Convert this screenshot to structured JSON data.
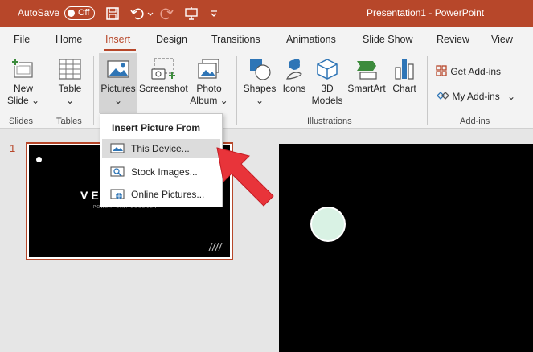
{
  "titlebar": {
    "autosave_label": "AutoSave",
    "autosave_state": "Off",
    "document_title": "Presentation1 - PowerPoint",
    "color": "#b7472a"
  },
  "tabs": [
    {
      "label": "File"
    },
    {
      "label": "Home"
    },
    {
      "label": "Insert",
      "active": true
    },
    {
      "label": "Design"
    },
    {
      "label": "Transitions"
    },
    {
      "label": "Animations"
    },
    {
      "label": "Slide Show"
    },
    {
      "label": "Review"
    },
    {
      "label": "View"
    }
  ],
  "ribbon": {
    "slides_group": {
      "new_slide_line1": "New",
      "new_slide_line2": "Slide",
      "label": "Slides"
    },
    "tables_group": {
      "table_label": "Table",
      "label": "Tables"
    },
    "images_group": {
      "pictures_label": "Pictures",
      "screenshot_label": "Screenshot",
      "photo_album_line1": "Photo",
      "photo_album_line2": "Album"
    },
    "illustrations_group": {
      "shapes_label": "Shapes",
      "icons_label": "Icons",
      "models_line1": "3D",
      "models_line2": "Models",
      "smartart_label": "SmartArt",
      "chart_label": "Chart",
      "label": "Illustrations"
    },
    "addins_group": {
      "get_addins_label": "Get Add-ins",
      "my_addins_label": "My Add-ins",
      "label": "Add-ins"
    }
  },
  "dropdown": {
    "header": "Insert Picture From",
    "items": [
      {
        "label": "This Device...",
        "icon": "device-picture-icon",
        "highlighted": true
      },
      {
        "label": "Stock Images...",
        "icon": "stock-images-icon"
      },
      {
        "label": "Online Pictures...",
        "icon": "online-pictures-icon"
      }
    ]
  },
  "slide_panel": {
    "slide_number": "1",
    "thumbnail_title": "VE",
    "thumbnail_subtitle": "POWERPOINT DOCUMENT"
  },
  "colors": {
    "accent": "#b7472a",
    "arrow": "#e8343a",
    "circle_fill": "#d9f2e4"
  }
}
